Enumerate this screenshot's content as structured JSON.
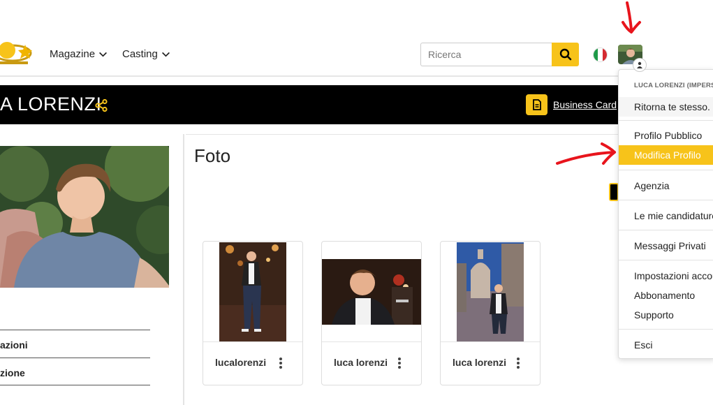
{
  "nav": {
    "items": [
      {
        "label": "Magazine"
      },
      {
        "label": "Casting"
      }
    ],
    "search": {
      "placeholder": "Ricerca"
    },
    "language": "it"
  },
  "profile": {
    "name": "A LORENZI",
    "business_card_label": "Business Card"
  },
  "left_menu": {
    "items": [
      {
        "label": "azioni"
      },
      {
        "label": "zione"
      }
    ]
  },
  "main": {
    "title": "Foto",
    "photos": [
      {
        "caption": "lucalorenzi"
      },
      {
        "caption": "luca lorenzi"
      },
      {
        "caption": "luca lorenzi"
      }
    ]
  },
  "dropdown": {
    "header": "LUCA LORENZI (IMPERS",
    "items": [
      {
        "label": "Ritorna te stesso."
      },
      {
        "label": "Profilo Pubblico"
      },
      {
        "label": "Modifica Profilo"
      },
      {
        "label": "Agenzia"
      },
      {
        "label": "Le mie candidature"
      },
      {
        "label": "Messaggi Privati"
      },
      {
        "label": "Impostazioni account"
      },
      {
        "label": "Abbonamento"
      },
      {
        "label": "Supporto"
      },
      {
        "label": "Esci"
      }
    ]
  },
  "colors": {
    "accent": "#f7c31a",
    "header_band": "#000000",
    "annotation": "#e8141c"
  }
}
